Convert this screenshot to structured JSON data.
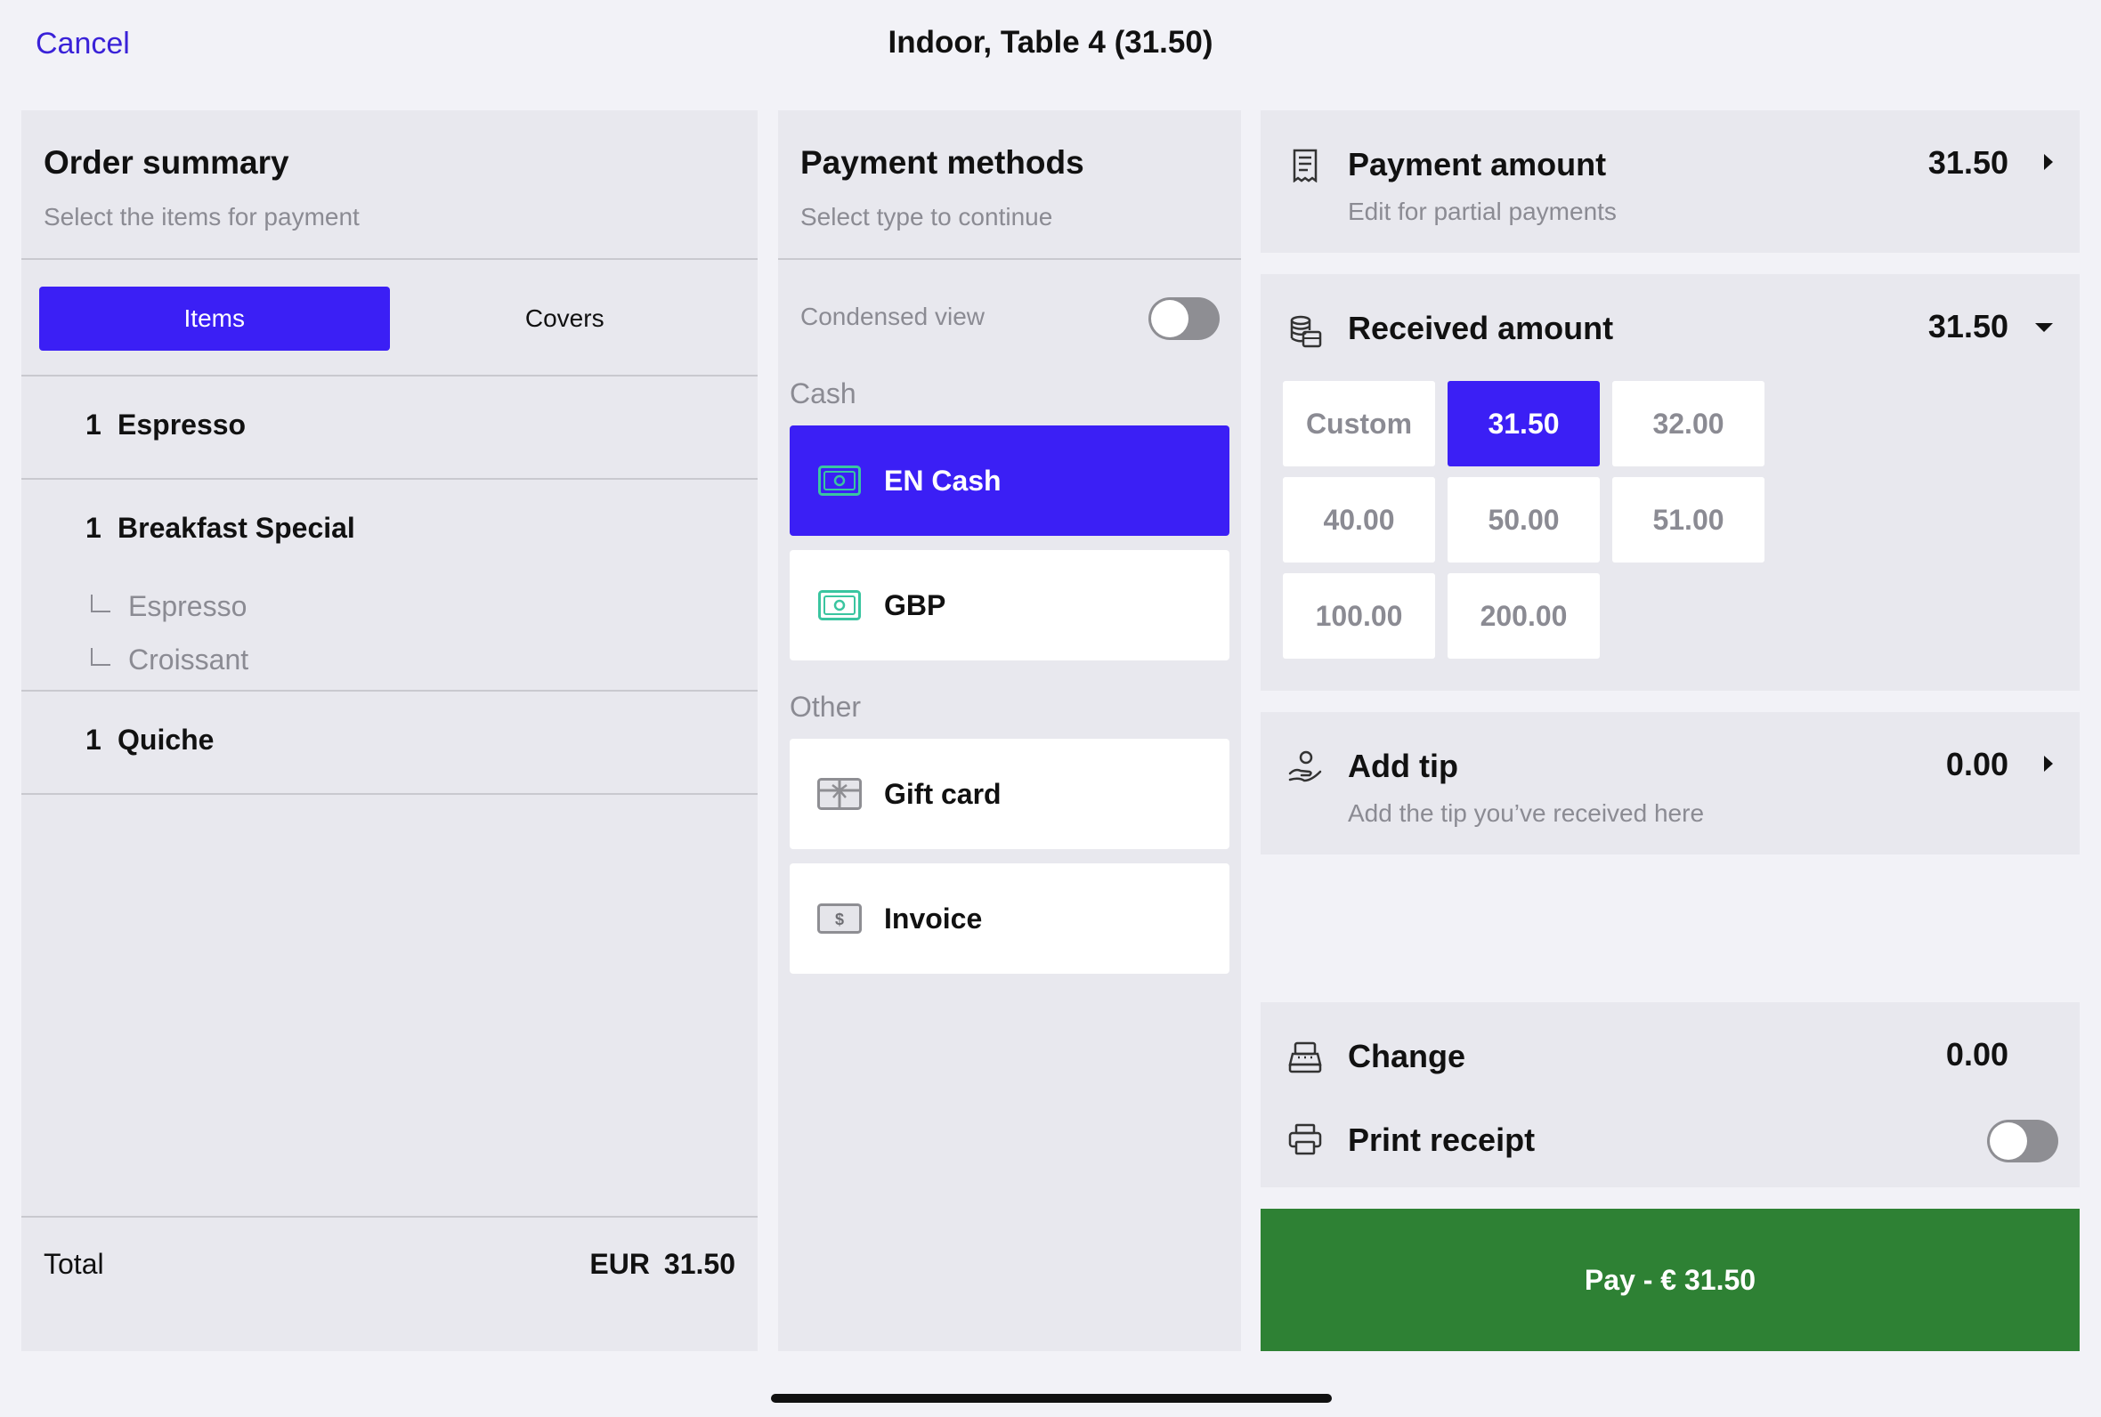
{
  "header": {
    "cancel": "Cancel",
    "title": "Indoor, Table 4 (31.50)"
  },
  "order_summary": {
    "title": "Order summary",
    "subtitle": "Select the items for payment",
    "tabs": [
      {
        "label": "Items",
        "selected": true
      },
      {
        "label": "Covers",
        "selected": false
      }
    ],
    "items": [
      {
        "qty": "1",
        "name": "Espresso",
        "modifiers": []
      },
      {
        "qty": "1",
        "name": "Breakfast Special",
        "modifiers": [
          "Espresso",
          "Croissant"
        ]
      },
      {
        "qty": "1",
        "name": "Quiche",
        "modifiers": []
      }
    ],
    "total_label": "Total",
    "total_currency": "EUR",
    "total_value": "31.50"
  },
  "payment_methods": {
    "title": "Payment methods",
    "subtitle": "Select type to continue",
    "condensed_label": "Condensed view",
    "condensed_on": false,
    "groups": [
      {
        "label": "Cash",
        "methods": [
          {
            "label": "EN Cash",
            "icon": "cash-icon",
            "selected": true
          },
          {
            "label": "GBP",
            "icon": "cash-icon",
            "selected": false
          }
        ]
      },
      {
        "label": "Other",
        "methods": [
          {
            "label": "Gift card",
            "icon": "gift-card-icon",
            "selected": false
          },
          {
            "label": "Invoice",
            "icon": "invoice-icon",
            "selected": false
          }
        ]
      }
    ]
  },
  "payment_amount": {
    "title": "Payment amount",
    "subtitle": "Edit for partial payments",
    "value": "31.50",
    "icon": "receipt-icon"
  },
  "received_amount": {
    "title": "Received amount",
    "value": "31.50",
    "icon": "coins-icon",
    "options": [
      "Custom",
      "31.50",
      "32.00",
      "40.00",
      "50.00",
      "51.00",
      "100.00",
      "200.00"
    ],
    "selected": "31.50"
  },
  "tip": {
    "title": "Add tip",
    "subtitle": "Add the tip you’ve received here",
    "value": "0.00",
    "icon": "hand-coin-icon"
  },
  "change": {
    "title": "Change",
    "value": "0.00",
    "icon": "cash-register-icon"
  },
  "print_receipt": {
    "title": "Print receipt",
    "on": false,
    "icon": "printer-icon"
  },
  "pay_button": "Pay - € 31.50",
  "colors": {
    "accent": "#3b1ff5",
    "pay": "#2e8134",
    "panel": "#e8e8ee",
    "background": "#f2f2f7",
    "cash_icon": "#3ac5a0"
  }
}
